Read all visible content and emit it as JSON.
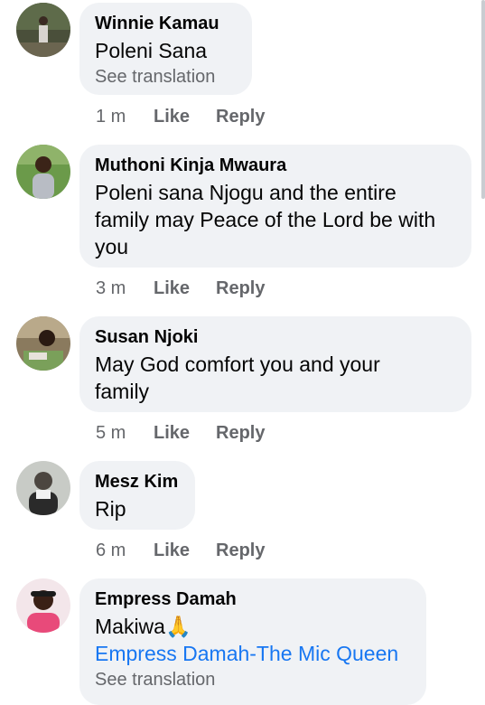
{
  "comments": [
    {
      "name": "Winnie Kamau",
      "text": "Poleni Sana",
      "see_translation": "See translation",
      "time": "1 m",
      "like": "Like",
      "reply": "Reply"
    },
    {
      "name": "Muthoni Kinja Mwaura",
      "text_lines": [
        "Poleni sana Njogu and the entire",
        "family may Peace of the Lord be with",
        "you"
      ],
      "time": "3 m",
      "like": "Like",
      "reply": "Reply"
    },
    {
      "name": "Susan Njoki",
      "text_lines": [
        "May God comfort you and your",
        "family"
      ],
      "time": "5 m",
      "like": "Like",
      "reply": "Reply"
    },
    {
      "name": "Mesz Kim",
      "text": "Rip",
      "time": "6 m",
      "like": "Like",
      "reply": "Reply"
    },
    {
      "name": "Empress Damah",
      "text": "Makiwa🙏",
      "link": "Empress Damah-The Mic Queen",
      "see_translation": "See translation"
    }
  ],
  "colors": {
    "bubble": "#f0f2f5",
    "meta_text": "#65676b",
    "link": "#1877f2"
  }
}
